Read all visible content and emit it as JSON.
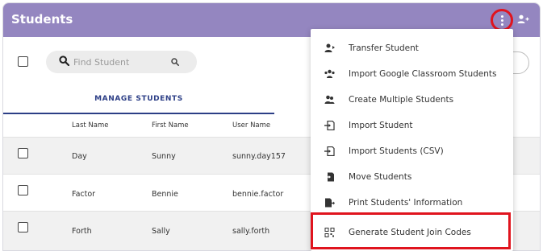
{
  "header": {
    "title": "Students"
  },
  "search": {
    "placeholder": "Find Student"
  },
  "tabs": [
    {
      "label": "MANAGE STUDENTS"
    }
  ],
  "table": {
    "columns": [
      "Last Name",
      "First Name",
      "User Name"
    ],
    "rows": [
      {
        "last": "Day",
        "first": "Sunny",
        "user": "sunny.day157"
      },
      {
        "last": "Factor",
        "first": "Bennie",
        "user": "bennie.factor"
      },
      {
        "last": "Forth",
        "first": "Sally",
        "user": "sally.forth"
      }
    ]
  },
  "menu": {
    "items": [
      {
        "label": "Transfer Student",
        "icon": "transfer-user-icon"
      },
      {
        "label": "Import Google Classroom Students",
        "icon": "group-import-icon"
      },
      {
        "label": "Create Multiple Students",
        "icon": "users-icon"
      },
      {
        "label": "Import Student",
        "icon": "file-import-icon"
      },
      {
        "label": "Import Students (CSV)",
        "icon": "file-import-icon"
      },
      {
        "label": "Move Students",
        "icon": "file-move-icon"
      },
      {
        "label": "Print Students' Information",
        "icon": "print-export-icon"
      },
      {
        "label": "Generate Student Join Codes",
        "icon": "qr-code-icon"
      }
    ]
  },
  "colors": {
    "header_bg": "#9486c0",
    "accent": "#2c3e86",
    "highlight_red": "#e0141e",
    "row_shade": "#f1f1f1"
  }
}
